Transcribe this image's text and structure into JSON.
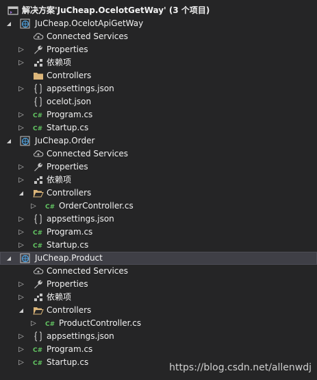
{
  "solution": {
    "label": "解决方案'JuCheap.OcelotGetWay' (3 个项目)"
  },
  "projects": [
    {
      "name": "JuCheap.OcelotApiGetWay",
      "connected_services": "Connected Services",
      "properties": "Properties",
      "dependencies": "依赖项",
      "controllers": "Controllers",
      "appsettings": "appsettings.json",
      "ocelot": "ocelot.json",
      "program": "Program.cs",
      "startup": "Startup.cs"
    },
    {
      "name": "JuCheap.Order",
      "connected_services": "Connected Services",
      "properties": "Properties",
      "dependencies": "依赖项",
      "controllers": "Controllers",
      "controller_file": "OrderController.cs",
      "appsettings": "appsettings.json",
      "program": "Program.cs",
      "startup": "Startup.cs"
    },
    {
      "name": "JuCheap.Product",
      "connected_services": "Connected Services",
      "properties": "Properties",
      "dependencies": "依赖项",
      "controllers": "Controllers",
      "controller_file": "ProductController.cs",
      "appsettings": "appsettings.json",
      "program": "Program.cs",
      "startup": "Startup.cs"
    }
  ],
  "watermark": "https://blog.csdn.net/allenwdj",
  "colors": {
    "background": "#252526",
    "selection": "#3f3f46",
    "text": "#f1f1f1",
    "csharp": "#62c462",
    "folder": "#dcb67a",
    "project": "#4fa3e0"
  }
}
